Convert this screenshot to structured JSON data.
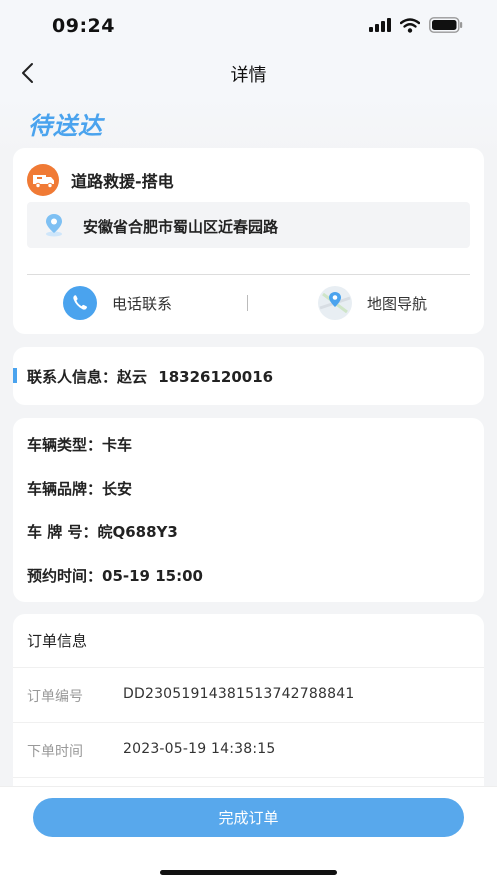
{
  "status_bar": {
    "time": "09:24"
  },
  "nav": {
    "title": "详情"
  },
  "order_status": "待送达",
  "service": {
    "name": "道路救援-搭电",
    "address": "安徽省合肥市蜀山区近春园路",
    "call_label": "电话联系",
    "map_label": "地图导航",
    "icon": "truck-icon"
  },
  "contact": {
    "label": "联系人信息：",
    "name": "赵云",
    "phone": "18326120016"
  },
  "vehicle": {
    "type_label": "车辆类型：",
    "type_value": "卡车",
    "brand_label": "车辆品牌：",
    "brand_value": "长安",
    "plate_label": "车 牌 号：",
    "plate_value": "皖Q688Y3",
    "appt_label": "预约时间：",
    "appt_value": "05-19 15:00"
  },
  "order_info": {
    "title": "订单信息",
    "number_label": "订单编号",
    "number_value": "DD23051914381513742788841",
    "time_label": "下单时间",
    "time_value": "2023-05-19 14:38:15"
  },
  "footer": {
    "complete_button": "完成订单"
  },
  "colors": {
    "accent": "#58a8ec",
    "status": "#4aa3ee",
    "service_icon": "#f07a35"
  }
}
